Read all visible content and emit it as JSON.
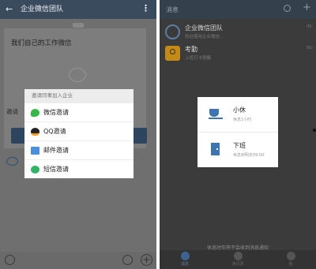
{
  "left": {
    "title": "企业微信团队",
    "back_icon": "back-arrow-icon",
    "more_icon": "more-vertical-icon",
    "card_heading": "我们自己的工作微信",
    "card_label": "邀请",
    "invite_menu": {
      "header": "邀请同事加入企业",
      "items": [
        {
          "label": "微信邀请",
          "icon": "wechat-icon"
        },
        {
          "label": "QQ邀请",
          "icon": "qq-icon"
        },
        {
          "label": "邮件邀请",
          "icon": "mail-icon"
        },
        {
          "label": "短信邀请",
          "icon": "sms-icon"
        }
      ]
    }
  },
  "right": {
    "title": "消息",
    "conversations": [
      {
        "name": "企业微信团队",
        "subtitle": "欢迎使用企业微信...",
        "time": "09:"
      },
      {
        "name": "考勤",
        "subtitle": "上班打卡提醒",
        "time": "09:"
      }
    ],
    "status_menu": [
      {
        "label": "小休",
        "sub": "休息1小时",
        "icon": "coffee-cup-icon"
      },
      {
        "label": "下班",
        "sub": "休息到明天09:00",
        "icon": "door-icon"
      }
    ],
    "note": "休息时你将不会收到消息通知",
    "tabs": [
      {
        "label": "消息"
      },
      {
        "label": "通讯录"
      },
      {
        "label": "我"
      }
    ]
  }
}
